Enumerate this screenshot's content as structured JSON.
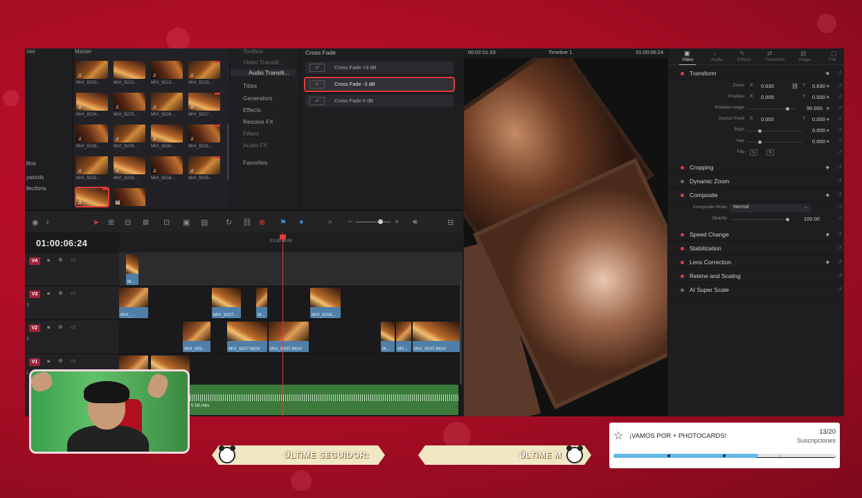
{
  "colors": {
    "accent_red": "#e23a3a",
    "clip_blue": "#4f7fa8",
    "audio_green": "#3b7a3b",
    "bg_red": "#c8102e",
    "goal_fill": "#62b8e6"
  },
  "media_pool": {
    "left_header": "ster",
    "header": "Master",
    "left_items": [
      "llins",
      "ywords",
      "llections"
    ],
    "clips": [
      "MVI_9220...",
      "MVI_9221...",
      "MVI_9222...",
      "MVI_9223...",
      "MVI_9224...",
      "MVI_9225...",
      "MVI_9226...",
      "MVI_9227...",
      "MVI_9228...",
      "MVI_9229...",
      "MVI_9230...",
      "MVI_9231...",
      "MVI_9232...",
      "MVI_9233...",
      "MVI_9234...",
      "MVI_9235...",
      "",
      ""
    ]
  },
  "effects_tree": {
    "items": [
      "Toolbox",
      "Video Transiti...",
      "Audio Transiti...",
      "Titles",
      "Generators",
      "Effects",
      "Resolve FX",
      "Filters",
      "Audio FX",
      "Favorites"
    ]
  },
  "effects_list": {
    "title": "Cross Fade",
    "items": [
      "Cross Fade +3 dB",
      "Cross Fade -3 dB",
      "Cross Fade 0 dB"
    ]
  },
  "timeline": {
    "timecode": "01:00:06:24",
    "ruler_label": "01:00:06:00",
    "tracks": [
      {
        "badge": "V4",
        "num": ""
      },
      {
        "badge": "V3",
        "num": "3"
      },
      {
        "badge": "V2",
        "num": "2"
      },
      {
        "badge": "V1",
        "num": "1"
      }
    ],
    "clips": {
      "v4": [
        "M..."
      ],
      "v3": [
        "MVI_...",
        "MVI_9207...",
        "M...",
        "MVI_9208..."
      ],
      "v2": [
        "MVI_920...",
        "MVI_9207.MOV",
        "MVI_9207.MOV",
        "M...",
        "MV...",
        "MVI_9207.MOV"
      ]
    },
    "audio_name": "5 58.mkv"
  },
  "viewer": {
    "left_tc": "00:02:01:33",
    "timeline_name": "Timeline 1",
    "right_tc": "01:00:06:24"
  },
  "inspector": {
    "tabs": [
      "Video",
      "Audio",
      "Effects",
      "Transition",
      "Image",
      "File"
    ],
    "transform": {
      "title": "Transform",
      "zoom_label": "Zoom",
      "zoom_x": "0.630",
      "zoom_y": "0.630",
      "position_label": "Position",
      "pos_x": "0.000",
      "pos_y": "0.000",
      "rotation_label": "Rotation Angle",
      "rotation": "90.000",
      "anchor_label": "Anchor Point",
      "anchor_x": "0.000",
      "anchor_y": "0.000",
      "pitch_label": "Pitch",
      "pitch": "0.000",
      "yaw_label": "Yaw",
      "yaw": "0.000",
      "flip_label": "Flip"
    },
    "sections": {
      "cropping": "Cropping",
      "dynamic_zoom": "Dynamic Zoom",
      "composite": "Composite",
      "speed_change": "Speed Change",
      "stabilization": "Stabilization",
      "lens_correction": "Lens Correction",
      "retime": "Retime and Scaling",
      "ai_super_scale": "AI Super Scale"
    },
    "composite": {
      "mode_label": "Composite Mode",
      "mode_value": "Normal",
      "opacity_label": "Opacity",
      "opacity_value": "100.00"
    }
  },
  "overlay": {
    "banner_left": "ÚLTIME SEGUIDOR:",
    "banner_right": "ÚLTIME M",
    "goal": {
      "title": "¡VAMOS POR + PHOTOCARDS!",
      "count": "13/20",
      "subtitle": "Suscripciones",
      "progress": 0.65
    }
  }
}
